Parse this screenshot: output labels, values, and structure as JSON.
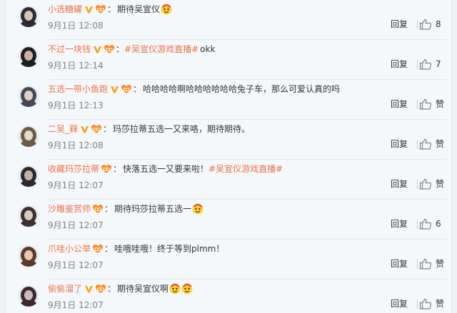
{
  "comments": [
    {
      "user": "小选糖罐",
      "text": "期待吴宣仪",
      "emojis_after": 1,
      "date": "9月1日",
      "time": "12:08",
      "reply": "回复",
      "likes": "8",
      "verified": true
    },
    {
      "user": "不过一块钱",
      "topic": "#吴宣仪游戏直播#",
      "text": " okk",
      "date": "9月1日",
      "time": "12:14",
      "reply": "回复",
      "likes": "7",
      "verified": true
    },
    {
      "user": "五选一带小鱼跑",
      "text": "哈哈哈哈啊哈哈哈哈哈哈兔子车，那么可爱认真的吗",
      "date": "9月1日",
      "time": "12:13",
      "reply": "回复",
      "likes": "赞",
      "verified": true
    },
    {
      "user": "二吴_槑",
      "text": "玛莎拉蒂五选一又来咯，期待期待。",
      "date": "9月1日",
      "time": "12:08",
      "reply": "回复",
      "likes": "赞",
      "verified": true
    },
    {
      "user": "收藏玛莎拉蒂",
      "text": "快落五选一又要来啦！",
      "topic_after": "#吴宣仪游戏直播#",
      "date": "9月1日",
      "time": "12:07",
      "reply": "回复",
      "likes": "赞",
      "verified": false
    },
    {
      "user": "沙雕鉴赏师",
      "text": "期待玛莎拉蒂五选一",
      "emojis_after": 1,
      "date": "9月1日",
      "time": "12:07",
      "reply": "回复",
      "likes": "6",
      "verified": false
    },
    {
      "user": "爪哇小公举",
      "text": "哇哦哇哦！终于等到plmm！",
      "date": "9月1日",
      "time": "12:07",
      "reply": "回复",
      "likes": "赞",
      "verified": false
    },
    {
      "user": "偷偷溜了",
      "text": "期待吴宣仪啊",
      "emojis_after": 2,
      "date": "9月1日",
      "time": "12:07",
      "reply": "回复",
      "likes": "赞",
      "verified": true
    }
  ],
  "colors": {
    "username": "#eb7350",
    "text": "#333333",
    "meta": "#808080",
    "background": "#f5f8fa"
  },
  "icons": {
    "verified": "v-badge-icon",
    "fan": "fan-badge-icon",
    "like": "thumbs-up-icon",
    "emoji": "emoji-icon"
  }
}
